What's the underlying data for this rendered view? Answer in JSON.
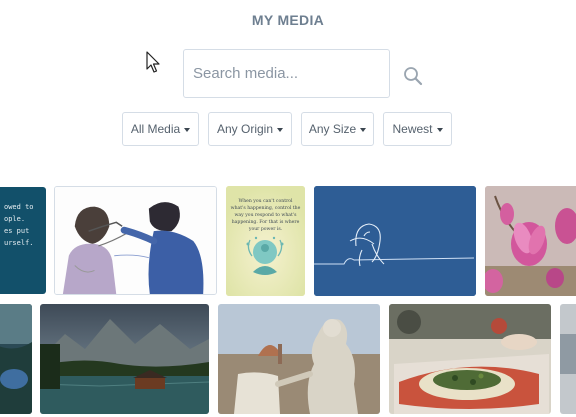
{
  "header": {
    "title": "MY MEDIA"
  },
  "search": {
    "placeholder": "Search media..."
  },
  "filters": [
    {
      "label": "All Media"
    },
    {
      "label": "Any Origin"
    },
    {
      "label": "Any Size"
    },
    {
      "label": "Newest"
    }
  ],
  "quote_card": {
    "lines": [
      "When you can't control",
      "what's happening, control the",
      "way you respond to what's",
      "happening. For that is where",
      "your power is."
    ]
  },
  "partial_text_card": {
    "lines": [
      "owed to",
      "ople.",
      "es put",
      "urself."
    ]
  },
  "icons": [
    "search-icon",
    "caret-down-icon",
    "mouse-pointer-icon"
  ],
  "colors": {
    "title": "#6e7f90",
    "border": "#d5dde6",
    "blue_card": "#2e5d95"
  }
}
